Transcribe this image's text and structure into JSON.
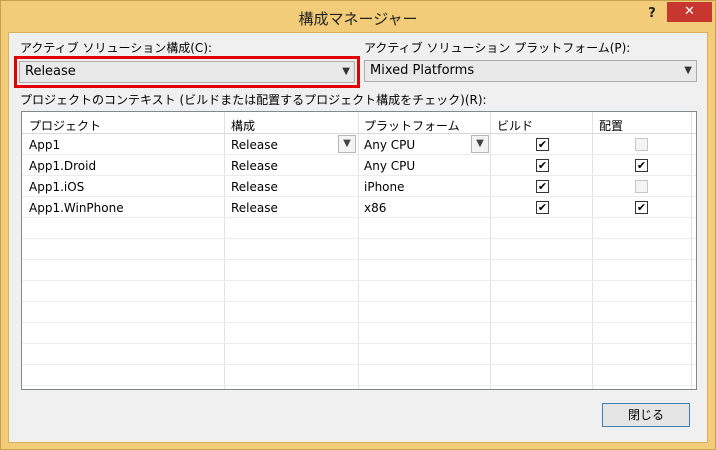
{
  "window": {
    "title": "構成マネージャー",
    "help_label": "?",
    "close_label": "✕"
  },
  "active_solution_config": {
    "label": "アクティブ ソリューション構成(C):",
    "value": "Release"
  },
  "active_solution_platform": {
    "label": "アクティブ ソリューション プラットフォーム(P):",
    "value": "Mixed Platforms"
  },
  "context_label": "プロジェクトのコンテキスト (ビルドまたは配置するプロジェクト構成をチェック)(R):",
  "grid": {
    "headers": {
      "project": "プロジェクト",
      "config": "構成",
      "platform": "プラットフォーム",
      "build": "ビルド",
      "deploy": "配置"
    },
    "rows": [
      {
        "project": "App1",
        "config": "Release",
        "platform": "Any CPU",
        "build": "✔",
        "deploy": ""
      },
      {
        "project": "App1.Droid",
        "config": "Release",
        "platform": "Any CPU",
        "build": "✔",
        "deploy": "✔"
      },
      {
        "project": "App1.iOS",
        "config": "Release",
        "platform": "iPhone",
        "build": "✔",
        "deploy": ""
      },
      {
        "project": "App1.WinPhone",
        "config": "Release",
        "platform": "x86",
        "build": "✔",
        "deploy": "✔"
      }
    ]
  },
  "close_button": "閉じる",
  "icons": {
    "dropdown": "chevron-down-icon",
    "check": "check-icon"
  },
  "colors": {
    "title_bar": "#f2cc78",
    "close_btn": "#c7372f",
    "highlight": "#e00000",
    "focus_border": "#3c7fb1"
  }
}
